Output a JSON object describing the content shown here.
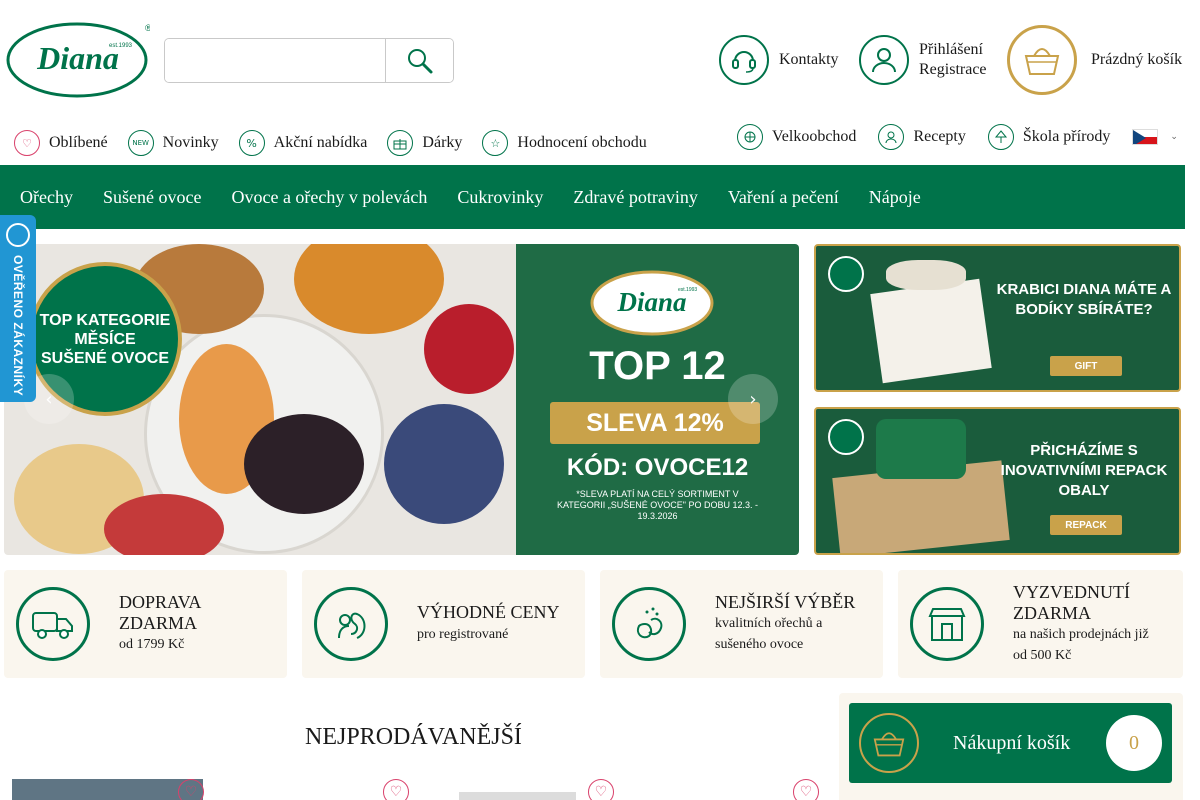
{
  "header": {
    "logo": {
      "brand": "Diana",
      "est": "est.1993"
    },
    "search": {
      "placeholder": ""
    },
    "contacts_label": "Kontakty",
    "login_label": "Přihlášení",
    "register_label": "Registrace",
    "cart_label": "Prázdný košík"
  },
  "subnav": {
    "left": [
      {
        "label": "Oblíbené",
        "icon": "heart-icon"
      },
      {
        "label": "Novinky",
        "icon": "new-icon",
        "icon_text": "NEW"
      },
      {
        "label": "Akční nabídka",
        "icon": "percent-icon",
        "icon_text": "%"
      },
      {
        "label": "Dárky",
        "icon": "gift-icon"
      },
      {
        "label": "Hodnocení obchodu",
        "icon": "star-icon"
      }
    ],
    "right": [
      {
        "label": "Velkoobchod",
        "icon": "wholesale-icon"
      },
      {
        "label": "Recepty",
        "icon": "chef-icon"
      },
      {
        "label": "Škola přírody",
        "icon": "tree-icon"
      }
    ],
    "language": "cs"
  },
  "menu": [
    "Ořechy",
    "Sušené ovoce",
    "Ovoce a ořechy v polevách",
    "Cukrovinky",
    "Zdravé potraviny",
    "Vaření a pečení",
    "Nápoje"
  ],
  "verified": {
    "text": "OVĚŘENO ZÁKAZNÍKY"
  },
  "hero": {
    "badge_line1": "TOP KATEGORIE",
    "badge_line2": "MĚSÍCE",
    "badge_line3": "SUŠENÉ OVOCE",
    "logo_brand": "Diana",
    "logo_est": "est.1993",
    "top12": "TOP 12",
    "sale": "SLEVA 12%",
    "code": "KÓD: OVOCE12",
    "note": "*SLEVA PLATÍ NA CELÝ SORTIMENT V KATEGORII „SUŠENÉ OVOCE\" PO DOBU 12.3. - 19.3.2026",
    "prev_icon": "chevron-left-icon",
    "next_icon": "chevron-right-icon"
  },
  "promos": [
    {
      "title": "KRABICI DIANA MÁTE A BODÍKY SBÍRÁTE?",
      "button": "GIFT"
    },
    {
      "title": "PŘICHÁZÍME S INOVATIVNÍMI REPACK OBALY",
      "button": "REPACK"
    }
  ],
  "benefits": [
    {
      "title": "DOPRAVA ZDARMA",
      "sub": "od 1799 Kč",
      "icon": "truck-icon"
    },
    {
      "title": "VÝHODNÉ CENY",
      "sub": "pro registrované",
      "icon": "squirrel-icon"
    },
    {
      "title": "NEJŠIRŠÍ VÝBĚR",
      "sub": "kvalitních ořechů a sušeného ovoce",
      "icon": "nuts-icon"
    },
    {
      "title": "VYZVEDNUTÍ ZDARMA",
      "sub": "na našich prodejnách již od 500 Kč",
      "icon": "store-icon"
    }
  ],
  "bestsellers": {
    "title": "NEJPRODÁVANĚJŠÍ"
  },
  "cart_side": {
    "label": "Nákupní košík",
    "count": "0"
  },
  "colors": {
    "brand_green": "#00734a",
    "gold": "#c9a24a",
    "pink": "#d9416b",
    "verified_blue": "#2196d3",
    "benefit_bg": "#faf6ee"
  }
}
